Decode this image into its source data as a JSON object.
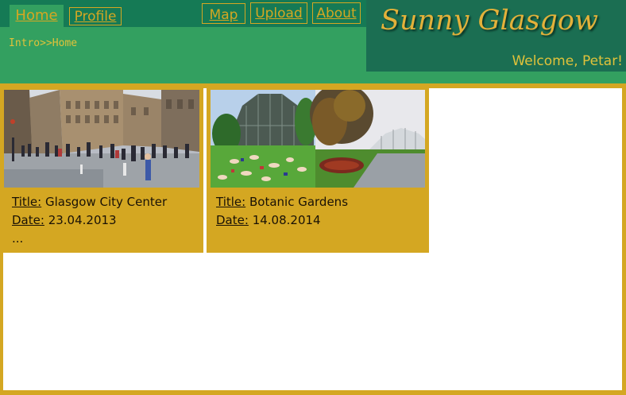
{
  "nav": {
    "home": "Home",
    "profile": "Profile",
    "map": "Map",
    "upload": "Upload",
    "about": "About"
  },
  "breadcrumb": "Intro>>Home",
  "brand": {
    "title": "Sunny Glasgow",
    "welcome": "Welcome, Petar!"
  },
  "labels": {
    "title": "Title:",
    "date": "Date:"
  },
  "cards": [
    {
      "title": "Glasgow City Center",
      "date": "23.04.2013",
      "extra": "..."
    },
    {
      "title": "Botanic Gardens",
      "date": "14.08.2014"
    }
  ],
  "colors": {
    "gold": "#d4a722",
    "green": "#33a060",
    "dark_green": "#157a55",
    "brand_green": "#1b6e52"
  }
}
